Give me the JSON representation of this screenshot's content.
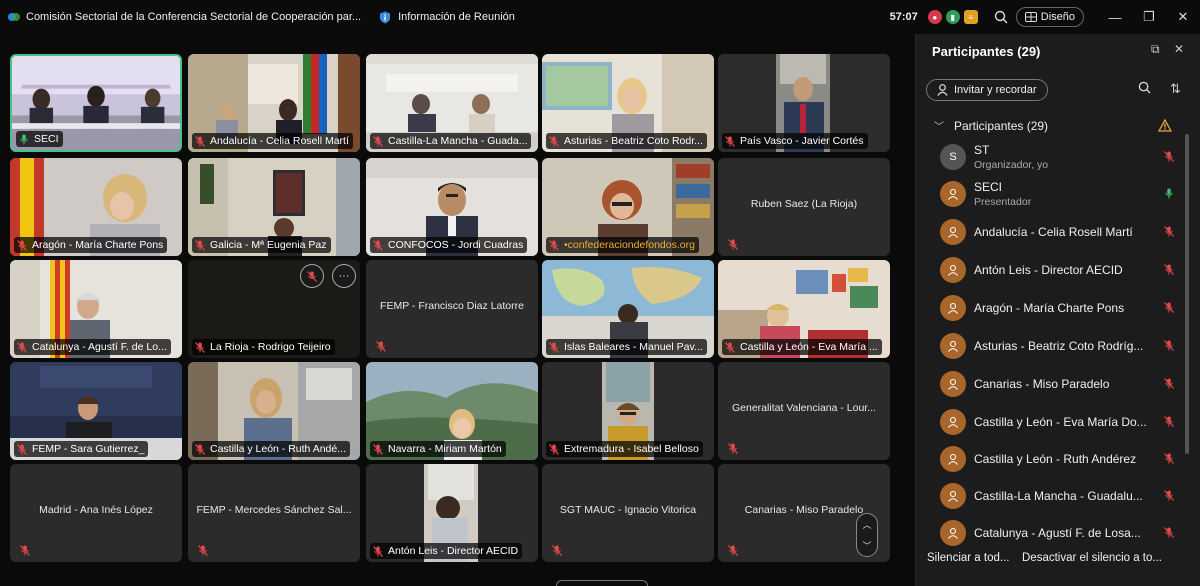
{
  "window": {
    "title": "Comisión Sectorial de la Conferencia Sectorial de Cooperación par...",
    "info_label": "Información de Reunión",
    "timer": "57:07",
    "layout_label": "Diseño"
  },
  "icons": {
    "app": "webex-icon",
    "info": "shield-info-icon",
    "search": "search-icon",
    "layout": "grid-layout-icon",
    "minimize": "minimize-icon",
    "restore": "restore-icon",
    "close": "close-icon",
    "mic_muted": "mic-muted-icon",
    "mic_on": "mic-icon"
  },
  "colors": {
    "active_border": "#47c08a",
    "muted_red": "#e5484d",
    "avatar_brown": "#a8662a",
    "mic_green": "#3fbf6f"
  },
  "tiles": [
    {
      "name": "SECI",
      "video": true,
      "active": true,
      "muted": false
    },
    {
      "name": "Andalucía - Celia Rosell Martí",
      "video": true,
      "muted": true
    },
    {
      "name": "Castilla-La Mancha - Guada...",
      "video": true,
      "muted": true
    },
    {
      "name": "Asturias - Beatriz Coto Rodr...",
      "video": true,
      "muted": true
    },
    {
      "name": "País Vasco - Javier Cortés",
      "video": true,
      "muted": true
    },
    {
      "name": "Aragón - María Charte Pons",
      "video": true,
      "muted": true
    },
    {
      "name": "Galicia - Mª Eugenia Paz",
      "video": true,
      "muted": true
    },
    {
      "name": "CONFOCOS - Jordi Cuadras",
      "video": true,
      "muted": true
    },
    {
      "name": "•confederaciondefondos.org",
      "video": true,
      "muted": true
    },
    {
      "name": "Ruben Saez (La Rioja)",
      "video": false,
      "muted": true
    },
    {
      "name": "Catalunya - Agustí F. de Lo...",
      "video": true,
      "muted": true
    },
    {
      "name": "La Rioja - Rodrigo Teijeiro",
      "video": true,
      "muted": true
    },
    {
      "name": "FEMP - Francisco Diaz Latorre",
      "video": false,
      "muted": true
    },
    {
      "name": "Islas Baleares - Manuel Pav...",
      "video": true,
      "muted": true
    },
    {
      "name": "Castilla y León - Eva María ...",
      "video": true,
      "muted": true
    },
    {
      "name": "FEMP - Sara Gutierrez_",
      "video": true,
      "muted": true
    },
    {
      "name": "Castilla y León - Ruth Andé...",
      "video": true,
      "muted": true
    },
    {
      "name": "Navarra - Miriam Martón",
      "video": true,
      "muted": true
    },
    {
      "name": "Extremadura - Isabel Belloso",
      "video": true,
      "muted": true
    },
    {
      "name": "Generalitat Valenciana - Lour...",
      "video": false,
      "muted": true
    },
    {
      "name": "Madrid - Ana Inés López",
      "video": false,
      "muted": true
    },
    {
      "name": "FEMP - Mercedes Sánchez Sal...",
      "video": false,
      "muted": true
    },
    {
      "name": "Antón Leis - Director AECID",
      "video": true,
      "muted": true
    },
    {
      "name": "SGT MAUC - Ignacio Vitorica",
      "video": false,
      "muted": true
    },
    {
      "name": "Canarias - Miso Paradelo",
      "video": false,
      "muted": true
    }
  ],
  "panel": {
    "title": "Participantes (29)",
    "invite_label": "Invitar y recordar",
    "section_label": "Participantes (29)",
    "participants": [
      {
        "initials": "S",
        "name": "ST",
        "role": "Organizador, yo",
        "mic": "muted"
      },
      {
        "initials": "",
        "name": "SECI",
        "role": "Presentador",
        "mic": "on"
      },
      {
        "initials": "",
        "name": "Andalucía - Celia Rosell Martí",
        "role": "",
        "mic": "muted"
      },
      {
        "initials": "",
        "name": "Antón Leis - Director AECID",
        "role": "",
        "mic": "muted"
      },
      {
        "initials": "",
        "name": "Aragón - María Charte Pons",
        "role": "",
        "mic": "muted"
      },
      {
        "initials": "",
        "name": "Asturias - Beatriz Coto Rodríg...",
        "role": "",
        "mic": "muted"
      },
      {
        "initials": "",
        "name": "Canarias - Miso Paradelo",
        "role": "",
        "mic": "muted"
      },
      {
        "initials": "",
        "name": "Castilla y León - Eva María Do...",
        "role": "",
        "mic": "muted"
      },
      {
        "initials": "",
        "name": "Castilla y León - Ruth Andérez",
        "role": "",
        "mic": "muted"
      },
      {
        "initials": "",
        "name": "Castilla-La Mancha - Guadalu...",
        "role": "",
        "mic": "muted"
      },
      {
        "initials": "",
        "name": "Catalunya - Agustí F. de Losa...",
        "role": "",
        "mic": "muted"
      }
    ],
    "mute_all_label": "Silenciar a tod...",
    "unmute_all_label": "Desactivar el silencio a to..."
  }
}
